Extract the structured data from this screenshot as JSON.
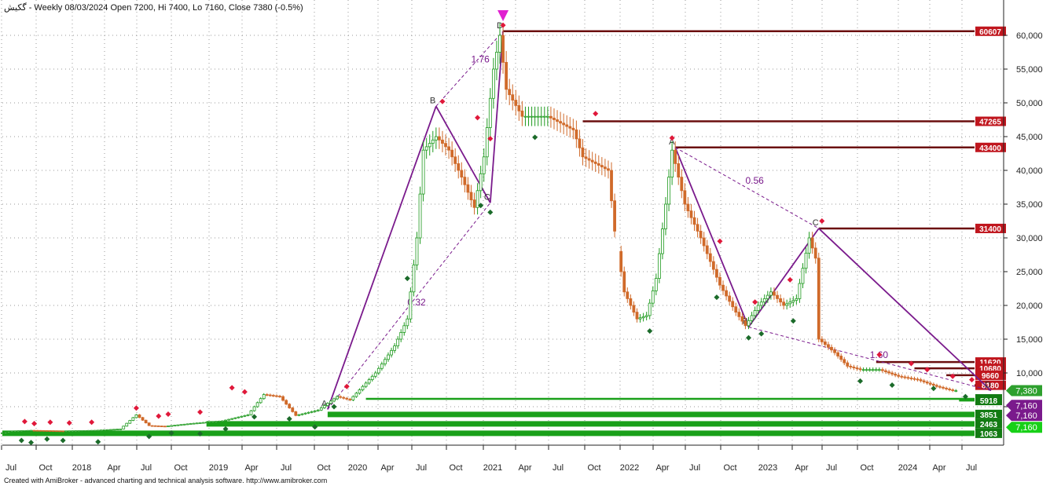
{
  "header": {
    "title": "گکیش - Weekly 08/03/2024 Open 7200, Hi 7400, Lo 7160, Close 7380 (-0.5%)"
  },
  "footer": {
    "credit": "Created with AmiBroker - advanced charting and technical analysis software. http://www.amibroker.com"
  },
  "colors": {
    "price_up": "#1f9a1f",
    "price_down": "#d06a2a",
    "pattern_line": "#7a1a8c",
    "resistance": "#6b0f0f",
    "support": "#1aa01a",
    "marker_top": "#e0183a",
    "marker_bottom": "#1b6b2a",
    "arrow": "#e020d0"
  },
  "chart_data": {
    "type": "candlestick",
    "interval": "Weekly",
    "x_tick_labels": [
      "Jul",
      "Oct",
      "2018",
      "Apr",
      "Jul",
      "Oct",
      "2019",
      "Apr",
      "Jul",
      "Oct",
      "2020",
      "Apr",
      "Jul",
      "Oct",
      "2021",
      "Apr",
      "Jul",
      "Oct",
      "2022",
      "Apr",
      "Jul",
      "Oct",
      "2023",
      "Apr",
      "Jul",
      "Oct",
      "2024",
      "Apr",
      "Jul"
    ],
    "y_ticks": [
      5000,
      10000,
      15000,
      20000,
      25000,
      30000,
      35000,
      40000,
      45000,
      50000,
      55000,
      60000
    ],
    "y_tick_labels": [
      "5,000",
      "10,000",
      "15,000",
      "20,000",
      "25,000",
      "30,000",
      "35,000",
      "40,000",
      "45,000",
      "50,000",
      "55,000",
      "60,000"
    ],
    "ylim": [
      0,
      65000
    ],
    "grid": true,
    "price_path": [
      {
        "t": 0,
        "v": 1000
      },
      {
        "t": 4,
        "v": 1400
      },
      {
        "t": 10,
        "v": 1500
      },
      {
        "t": 20,
        "v": 1400
      },
      {
        "t": 30,
        "v": 1500
      },
      {
        "t": 38,
        "v": 1700
      },
      {
        "t": 43,
        "v": 3800
      },
      {
        "t": 47,
        "v": 2200
      },
      {
        "t": 52,
        "v": 2100
      },
      {
        "t": 60,
        "v": 2500
      },
      {
        "t": 70,
        "v": 2900
      },
      {
        "t": 78,
        "v": 3800
      },
      {
        "t": 83,
        "v": 6800
      },
      {
        "t": 88,
        "v": 6500
      },
      {
        "t": 93,
        "v": 3700
      },
      {
        "t": 100,
        "v": 4500
      },
      {
        "t": 106,
        "v": 6500
      },
      {
        "t": 110,
        "v": 6000
      },
      {
        "t": 118,
        "v": 10000
      },
      {
        "t": 124,
        "v": 14000
      },
      {
        "t": 128,
        "v": 18000
      },
      {
        "t": 131,
        "v": 30000
      },
      {
        "t": 133,
        "v": 43000
      },
      {
        "t": 137,
        "v": 45000
      },
      {
        "t": 141,
        "v": 43000
      },
      {
        "t": 145,
        "v": 39000
      },
      {
        "t": 149,
        "v": 34500
      },
      {
        "t": 152,
        "v": 42000
      },
      {
        "t": 155,
        "v": 55000
      },
      {
        "t": 157,
        "v": 60000
      },
      {
        "t": 159,
        "v": 52000
      },
      {
        "t": 164,
        "v": 48000
      },
      {
        "t": 172,
        "v": 48000
      },
      {
        "t": 180,
        "v": 46000
      },
      {
        "t": 183,
        "v": 42000
      },
      {
        "t": 191,
        "v": 40000
      },
      {
        "t": 193,
        "v": 31000
      },
      {
        "t": 196,
        "v": 22000
      },
      {
        "t": 200,
        "v": 18000
      },
      {
        "t": 203,
        "v": 18500
      },
      {
        "t": 206,
        "v": 24000
      },
      {
        "t": 209,
        "v": 35000
      },
      {
        "t": 211,
        "v": 43000
      },
      {
        "t": 215,
        "v": 35000
      },
      {
        "t": 220,
        "v": 30000
      },
      {
        "t": 226,
        "v": 23000
      },
      {
        "t": 231,
        "v": 19000
      },
      {
        "t": 234,
        "v": 17000
      },
      {
        "t": 238,
        "v": 20000
      },
      {
        "t": 242,
        "v": 22000
      },
      {
        "t": 246,
        "v": 20000
      },
      {
        "t": 250,
        "v": 21000
      },
      {
        "t": 254,
        "v": 30000
      },
      {
        "t": 256,
        "v": 27000
      },
      {
        "t": 257,
        "v": 15000
      },
      {
        "t": 262,
        "v": 13000
      },
      {
        "t": 266,
        "v": 11000
      },
      {
        "t": 270,
        "v": 10500
      },
      {
        "t": 276,
        "v": 10500
      },
      {
        "t": 282,
        "v": 9500
      },
      {
        "t": 288,
        "v": 9000
      },
      {
        "t": 294,
        "v": 8000
      },
      {
        "t": 299,
        "v": 7380
      }
    ],
    "pattern_points": [
      {
        "label": "A",
        "t": 102,
        "v": 4600
      },
      {
        "label": "B",
        "t": 136,
        "v": 49500
      },
      {
        "label": "C",
        "t": 153,
        "v": 35200
      },
      {
        "label": "D",
        "t": 157,
        "v": 60600
      },
      {
        "label": "A",
        "t": 211,
        "v": 43400
      },
      {
        "label": "B",
        "t": 234,
        "v": 16800
      },
      {
        "label": "C",
        "t": 256,
        "v": 31400
      },
      {
        "label": "D",
        "t": 310,
        "v": 7380
      }
    ],
    "fib_labels": [
      {
        "text": "1.76",
        "t": 147,
        "v": 56000
      },
      {
        "text": "0.32",
        "t": 127,
        "v": 20000
      },
      {
        "text": "0.56",
        "t": 233,
        "v": 38000
      },
      {
        "text": "1.60",
        "t": 272,
        "v": 12200
      }
    ],
    "resistance_levels": [
      {
        "value": 60607,
        "label": "60607",
        "t_start": 157
      },
      {
        "value": 47265,
        "label": "47265",
        "t_start": 182
      },
      {
        "value": 43400,
        "label": "43400",
        "t_start": 211
      },
      {
        "value": 31400,
        "label": "31400",
        "t_start": 256
      },
      {
        "value": 11620,
        "label": "11620",
        "t_start": 274
      },
      {
        "value": 10680,
        "label": "10680",
        "t_start": 286
      },
      {
        "value": 9660,
        "label": "9660",
        "t_start": 296
      },
      {
        "value": 8180,
        "label": "8180",
        "t_start": 306
      }
    ],
    "support_levels": [
      {
        "value": 6160,
        "label": "7160",
        "t_start": 114
      },
      {
        "value": 5918,
        "label": "5918",
        "t_start": 300
      },
      {
        "value": 3851,
        "label": "3851",
        "t_start": 102
      },
      {
        "value": 2463,
        "label": "2463",
        "t_start": 64
      },
      {
        "value": 1063,
        "label": "1063",
        "t_start": 0
      }
    ],
    "price_tags": [
      {
        "text": "7,380",
        "value": 7380,
        "color": "#2ea02e"
      },
      {
        "text": "7,160",
        "value": 5200,
        "color": "#7a1a8c"
      },
      {
        "text": "7,160",
        "value": 3700,
        "color": "#7a1a8c"
      },
      {
        "text": "7,160",
        "value": 1950,
        "color": "#17d017"
      }
    ],
    "top_markers": [
      {
        "t": 7,
        "v": 2800
      },
      {
        "t": 10,
        "v": 2500
      },
      {
        "t": 15,
        "v": 2700
      },
      {
        "t": 21,
        "v": 2600
      },
      {
        "t": 28,
        "v": 2700
      },
      {
        "t": 42,
        "v": 4800
      },
      {
        "t": 49,
        "v": 3600
      },
      {
        "t": 52,
        "v": 3900
      },
      {
        "t": 62,
        "v": 4200
      },
      {
        "t": 72,
        "v": 7800
      },
      {
        "t": 76,
        "v": 7200
      },
      {
        "t": 108,
        "v": 8000
      },
      {
        "t": 138,
        "v": 50200
      },
      {
        "t": 149,
        "v": 47800
      },
      {
        "t": 153,
        "v": 44700
      },
      {
        "t": 157,
        "v": 61500
      },
      {
        "t": 186,
        "v": 48400
      },
      {
        "t": 210,
        "v": 44800
      },
      {
        "t": 225,
        "v": 29500
      },
      {
        "t": 236,
        "v": 20500
      },
      {
        "t": 247,
        "v": 23800
      },
      {
        "t": 257,
        "v": 32500
      },
      {
        "t": 275,
        "v": 12700
      },
      {
        "t": 285,
        "v": 11400
      },
      {
        "t": 290,
        "v": 10500
      },
      {
        "t": 298,
        "v": 9500
      },
      {
        "t": 304,
        "v": 9000
      }
    ],
    "bottom_markers": [
      {
        "t": 6,
        "v": 0
      },
      {
        "t": 9,
        "v": -300
      },
      {
        "t": 14,
        "v": 200
      },
      {
        "t": 19,
        "v": 0
      },
      {
        "t": 30,
        "v": -200
      },
      {
        "t": 46,
        "v": 600
      },
      {
        "t": 53,
        "v": 1100
      },
      {
        "t": 62,
        "v": 1000
      },
      {
        "t": 70,
        "v": 1700
      },
      {
        "t": 79,
        "v": 3500
      },
      {
        "t": 90,
        "v": 3200
      },
      {
        "t": 98,
        "v": 2000
      },
      {
        "t": 104,
        "v": 5000
      },
      {
        "t": 127,
        "v": 24000
      },
      {
        "t": 150,
        "v": 34800
      },
      {
        "t": 153,
        "v": 33800
      },
      {
        "t": 167,
        "v": 44900
      },
      {
        "t": 203,
        "v": 16200
      },
      {
        "t": 224,
        "v": 21200
      },
      {
        "t": 234,
        "v": 15200
      },
      {
        "t": 238,
        "v": 15800
      },
      {
        "t": 248,
        "v": 17700
      },
      {
        "t": 269,
        "v": 8800
      },
      {
        "t": 279,
        "v": 8200
      },
      {
        "t": 292,
        "v": 7700
      },
      {
        "t": 302,
        "v": 6500
      }
    ]
  }
}
